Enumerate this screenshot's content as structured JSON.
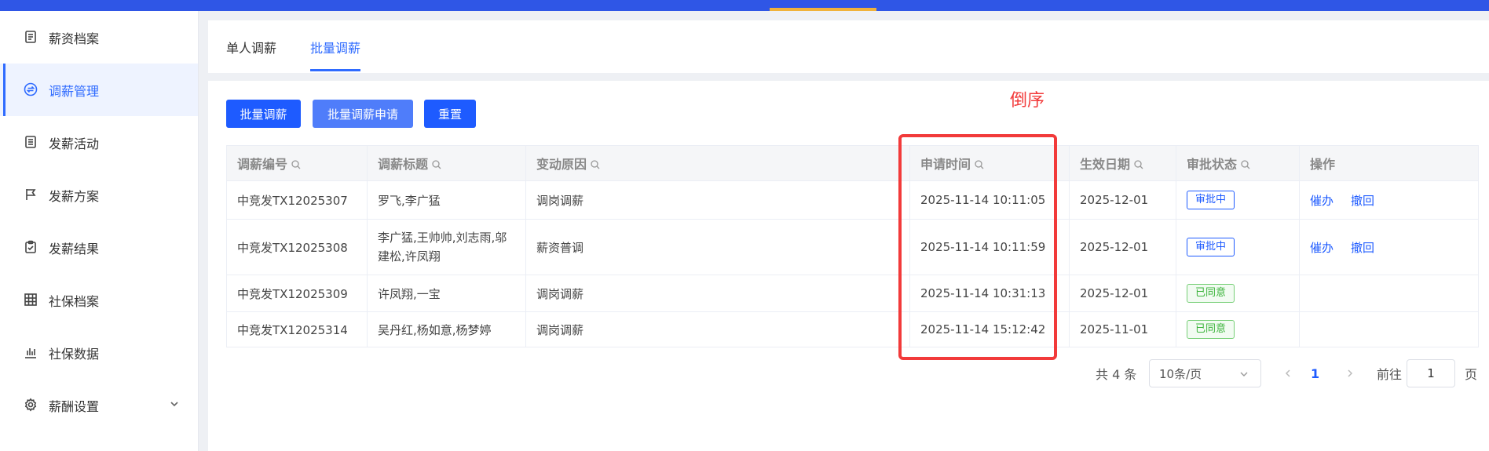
{
  "sidebar": {
    "items": [
      {
        "label": "薪资档案",
        "icon": "document-icon"
      },
      {
        "label": "调薪管理",
        "icon": "exchange-icon",
        "active": true
      },
      {
        "label": "发薪活动",
        "icon": "list-doc-icon"
      },
      {
        "label": "发薪方案",
        "icon": "flag-icon"
      },
      {
        "label": "发薪结果",
        "icon": "clipboard-check-icon"
      },
      {
        "label": "社保档案",
        "icon": "building-icon"
      },
      {
        "label": "社保数据",
        "icon": "bar-chart-icon"
      },
      {
        "label": "薪酬设置",
        "icon": "gear-icon",
        "expandable": true
      }
    ]
  },
  "tabs": [
    {
      "label": "单人调薪"
    },
    {
      "label": "批量调薪",
      "active": true
    }
  ],
  "toolbar": {
    "batch_adjust": "批量调薪",
    "batch_apply": "批量调薪申请",
    "reset": "重置"
  },
  "table": {
    "columns": [
      "调薪编号",
      "调薪标题",
      "变动原因",
      "申请时间",
      "生效日期",
      "审批状态",
      "操作"
    ],
    "rows": [
      {
        "id": "中竞发TX12025307",
        "title": "罗飞,李广猛",
        "reason": "调岗调薪",
        "apply_time": "2025-11-14 10:11:05",
        "effective": "2025-12-01",
        "status": "审批中",
        "status_color": "#1e5bff",
        "ops": [
          "催办",
          "撤回"
        ]
      },
      {
        "id": "中竞发TX12025308",
        "title": "李广猛,王帅帅,刘志雨,邬建松,许凤翔",
        "reason": "薪资普调",
        "apply_time": "2025-11-14 10:11:59",
        "effective": "2025-12-01",
        "status": "审批中",
        "status_color": "#1e5bff",
        "ops": [
          "催办",
          "撤回"
        ]
      },
      {
        "id": "中竞发TX12025309",
        "title": "许凤翔,一宝",
        "reason": "调岗调薪",
        "apply_time": "2025-11-14 10:31:13",
        "effective": "2025-12-01",
        "status": "已同意",
        "status_color": "#3cb43c",
        "ops": []
      },
      {
        "id": "中竞发TX12025314",
        "title": "吴丹红,杨如意,杨梦婷",
        "reason": "调岗调薪",
        "apply_time": "2025-11-14 15:12:42",
        "effective": "2025-11-01",
        "status": "已同意",
        "status_color": "#3cb43c",
        "ops": []
      }
    ]
  },
  "pagination": {
    "total": "共 4 条",
    "page_size": "10条/页",
    "current_page": "1",
    "goto_label": "前往",
    "goto_value": "1",
    "page_suffix": "页"
  },
  "annotation": {
    "text": "倒序",
    "color": "#f23a3a"
  },
  "colors": {
    "primary": "#1e5bff",
    "topbar": "#2f56e6",
    "accent": "#f0b23a"
  }
}
